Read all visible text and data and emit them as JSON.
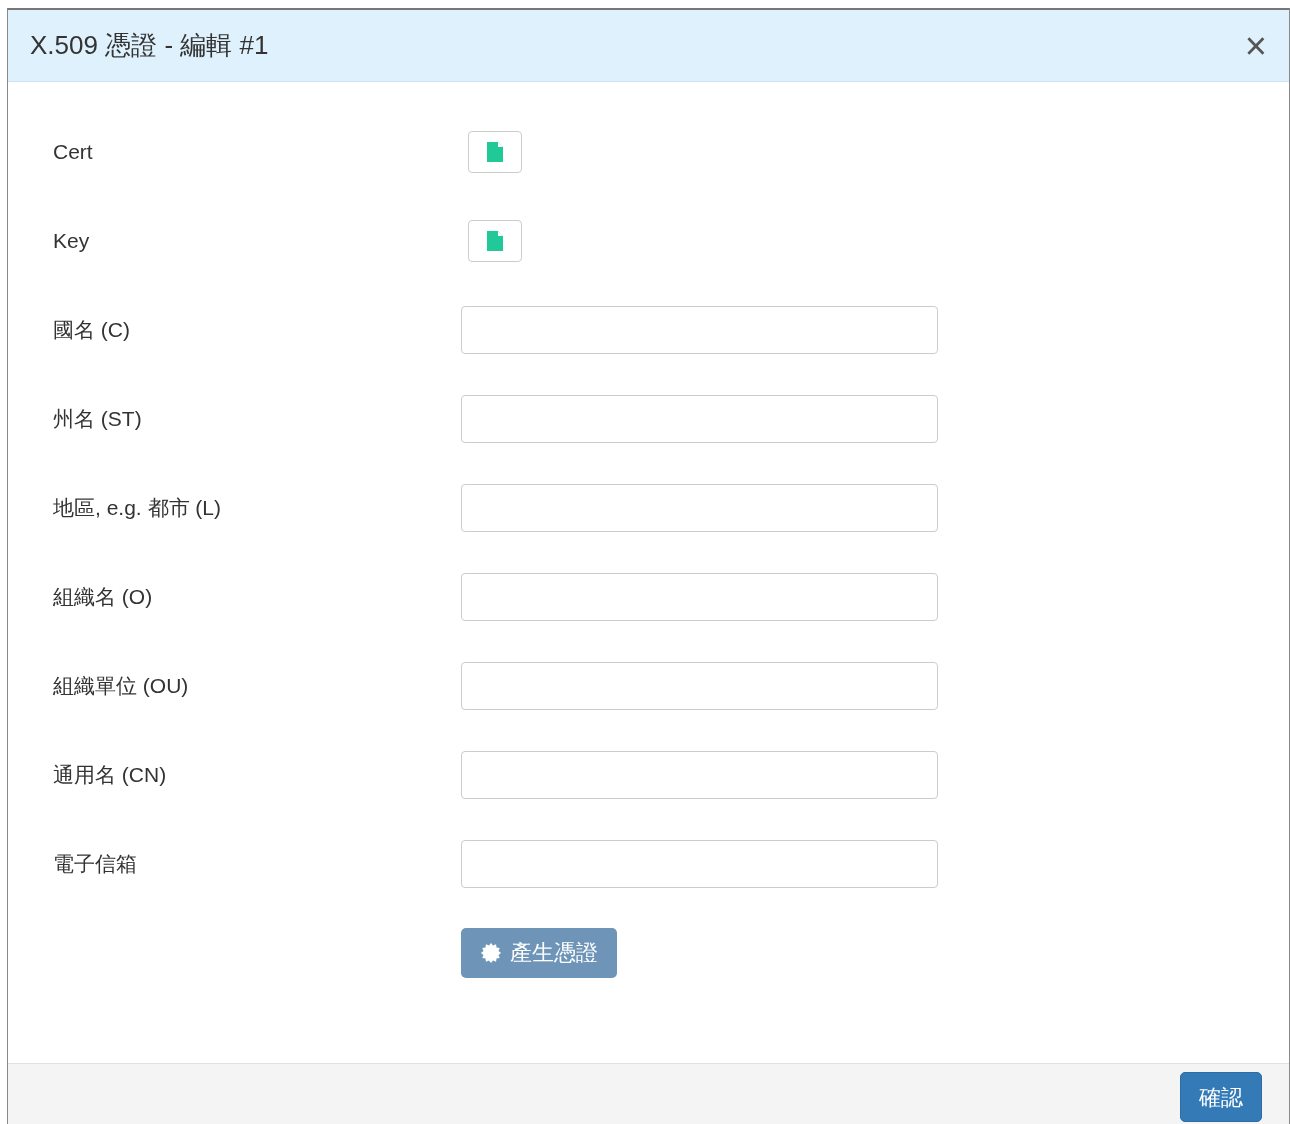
{
  "dialog": {
    "title": "X.509 憑證 - 編輯 #1",
    "close": "×"
  },
  "rows": [
    {
      "kind": "file",
      "label": "Cert"
    },
    {
      "kind": "file",
      "label": "Key"
    },
    {
      "kind": "text",
      "label": "國名 (C)"
    },
    {
      "kind": "text",
      "label": "州名 (ST)"
    },
    {
      "kind": "text",
      "label": "地區, e.g. 都市 (L)"
    },
    {
      "kind": "text",
      "label": "組織名 (O)"
    },
    {
      "kind": "text",
      "label": "組織單位 (OU)"
    },
    {
      "kind": "text",
      "label": "通用名 (CN)"
    },
    {
      "kind": "text",
      "label": "電子信箱"
    }
  ],
  "generate_button": {
    "label": "產生憑證",
    "disabled": true
  },
  "footer": {
    "confirm": "確認"
  }
}
